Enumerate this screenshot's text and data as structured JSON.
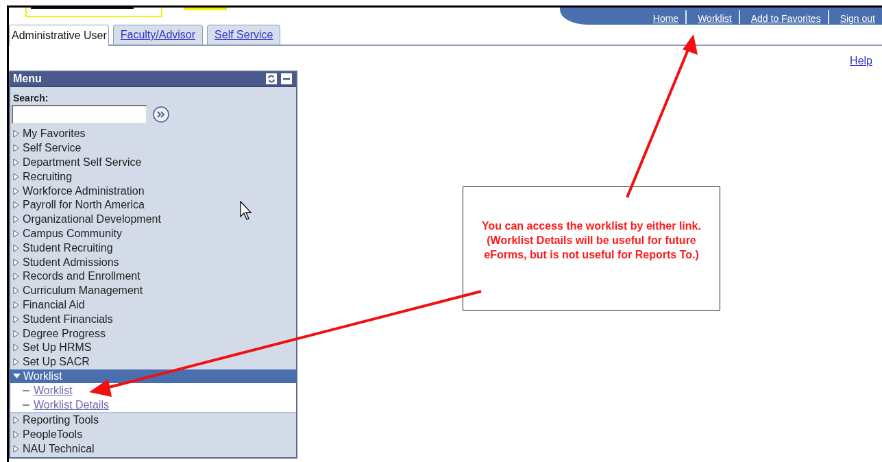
{
  "header_links": [
    "Home",
    "Worklist",
    "Add to Favorites",
    "Sign out"
  ],
  "tabs": [
    {
      "label": "Administrative User",
      "selected": true
    },
    {
      "label": "Faculty/Advisor",
      "selected": false
    },
    {
      "label": "Self Service",
      "selected": false
    }
  ],
  "help_link": "Help",
  "menu": {
    "title": "Menu",
    "search_label": "Search:",
    "items": [
      {
        "label": "My Favorites",
        "expanded": false
      },
      {
        "label": "Self Service",
        "expanded": false
      },
      {
        "label": "Department Self Service",
        "expanded": false
      },
      {
        "label": "Recruiting",
        "expanded": false
      },
      {
        "label": "Workforce Administration",
        "expanded": false
      },
      {
        "label": "Payroll for North America",
        "expanded": false
      },
      {
        "label": "Organizational Development",
        "expanded": false
      },
      {
        "label": "Campus Community",
        "expanded": false
      },
      {
        "label": "Student Recruiting",
        "expanded": false
      },
      {
        "label": "Student Admissions",
        "expanded": false
      },
      {
        "label": "Records and Enrollment",
        "expanded": false
      },
      {
        "label": "Curriculum Management",
        "expanded": false
      },
      {
        "label": "Financial Aid",
        "expanded": false
      },
      {
        "label": "Student Financials",
        "expanded": false
      },
      {
        "label": "Degree Progress",
        "expanded": false
      },
      {
        "label": "Set Up HRMS",
        "expanded": false
      },
      {
        "label": "Set Up SACR",
        "expanded": false
      },
      {
        "label": "Worklist",
        "expanded": true,
        "children": [
          {
            "label": "Worklist"
          },
          {
            "label": "Worklist Details"
          }
        ]
      },
      {
        "label": "Reporting Tools",
        "expanded": false
      },
      {
        "label": "PeopleTools",
        "expanded": false
      },
      {
        "label": "NAU Technical",
        "expanded": false
      }
    ]
  },
  "callout": {
    "text": "You can access the worklist by either link.  (Worklist Details will be useful for future eForms, but is not useful for Reports To.)"
  }
}
